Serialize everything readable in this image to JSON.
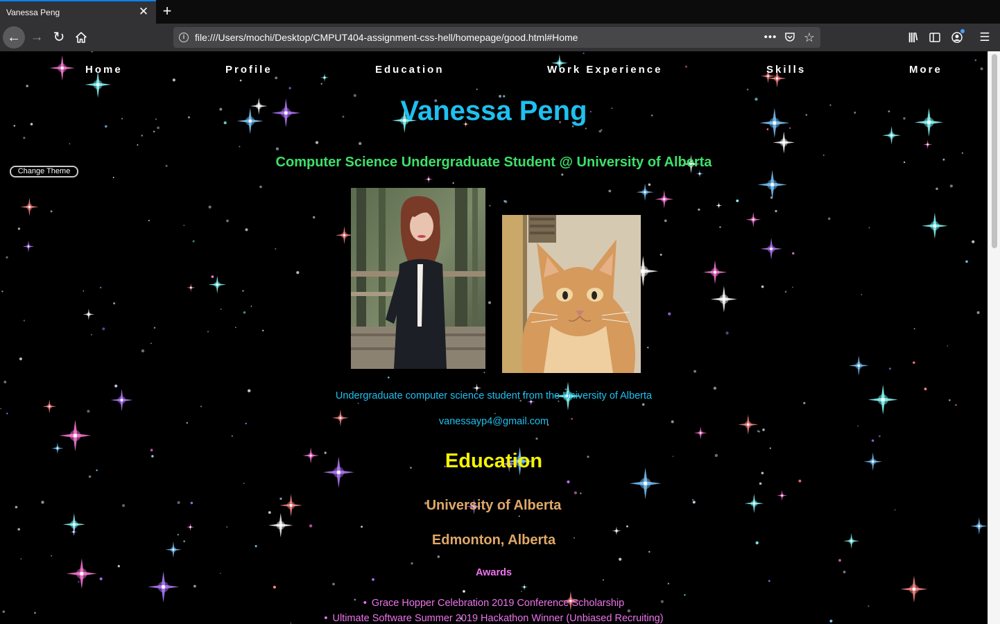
{
  "browser": {
    "tab_title": "Vanessa Peng",
    "url": "file:///Users/mochi/Desktop/CMPUT404-assignment-css-hell/homepage/good.html#Home",
    "icons": [
      "back-arrow-icon",
      "forward-arrow-icon",
      "reload-icon",
      "home-icon",
      "info-icon",
      "more-icon",
      "pocket-icon",
      "bookmark-star-icon",
      "library-icon",
      "sidebar-icon",
      "account-icon",
      "menu-icon"
    ]
  },
  "page": {
    "nav": [
      "Home",
      "Profile",
      "Education",
      "Work Experience",
      "Skills",
      "More"
    ],
    "name": "Vanessa Peng",
    "subtitle": "Computer Science Undergraduate Student @ University of Alberta",
    "theme_button": "Change Theme",
    "intro": "Undergraduate computer science student from the University of Alberta",
    "email": "vanessayp4@gmail.com",
    "education": {
      "heading": "Education",
      "university": "University of Alberta",
      "location": "Edmonton, Alberta",
      "awards_heading": "Awards",
      "awards": [
        "Grace Hopper Celebration 2019 Conference Scholarship",
        "Ultimate Software Summer 2019 Hackathon Winner (Unbiased Recruiting)"
      ]
    }
  },
  "colors": {
    "name": "#1ec0f0",
    "subtitle": "#3de06a",
    "education_heading": "#f5f500",
    "university": "#e0a868",
    "awards": "#ee74ee",
    "background": "#000000"
  }
}
